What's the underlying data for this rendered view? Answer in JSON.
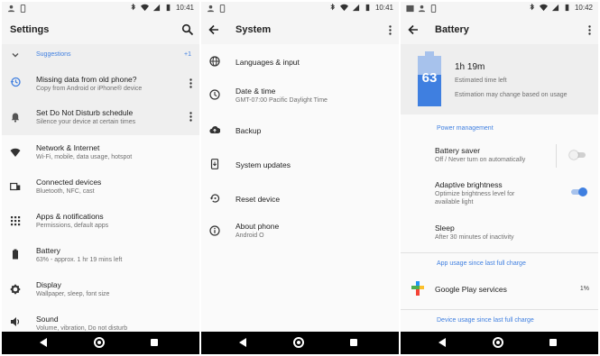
{
  "status": {
    "time_1": "10:41",
    "time_2": "10:41",
    "time_3": "10:42"
  },
  "settings": {
    "title": "Settings",
    "suggestions_label": "Suggestions",
    "suggestions_count": "+1",
    "items": [
      {
        "title": "Missing data from old phone?",
        "subtitle": "Copy from Android or iPhone® device",
        "icon": "history-icon"
      },
      {
        "title": "Set Do Not Disturb schedule",
        "subtitle": "Silence your device at certain times",
        "icon": "bell-icon"
      },
      {
        "title": "Network & Internet",
        "subtitle": "Wi-Fi, mobile, data usage, hotspot",
        "icon": "wifi-icon"
      },
      {
        "title": "Connected devices",
        "subtitle": "Bluetooth, NFC, cast",
        "icon": "devices-icon"
      },
      {
        "title": "Apps & notifications",
        "subtitle": "Permissions, default apps",
        "icon": "apps-icon"
      },
      {
        "title": "Battery",
        "subtitle": "63% - approx. 1 hr 19 mins left",
        "icon": "battery-icon"
      },
      {
        "title": "Display",
        "subtitle": "Wallpaper, sleep, font size",
        "icon": "brightness-icon"
      },
      {
        "title": "Sound",
        "subtitle": "Volume, vibration, Do not disturb",
        "icon": "volume-icon"
      }
    ]
  },
  "system": {
    "title": "System",
    "items": [
      {
        "title": "Languages & input",
        "subtitle": "",
        "icon": "globe-icon"
      },
      {
        "title": "Date & time",
        "subtitle": "GMT-07:00 Pacific Daylight Time",
        "icon": "clock-icon"
      },
      {
        "title": "Backup",
        "subtitle": "",
        "icon": "cloud-upload-icon"
      },
      {
        "title": "System updates",
        "subtitle": "",
        "icon": "system-update-icon"
      },
      {
        "title": "Reset device",
        "subtitle": "",
        "icon": "restore-icon"
      },
      {
        "title": "About phone",
        "subtitle": "Android O",
        "icon": "info-icon"
      }
    ]
  },
  "battery": {
    "title": "Battery",
    "level": "63",
    "level_fraction": 0.63,
    "time_left": "1h 19m",
    "estimated_label": "Estimated time left",
    "estimate_note": "Estimation may change based on usage",
    "power_management_label": "Power management",
    "saver_title": "Battery saver",
    "saver_subtitle": "Off / Never turn on automatically",
    "saver_on": false,
    "adaptive_title": "Adaptive brightness",
    "adaptive_subtitle_1": "Optimize brightness level for",
    "adaptive_subtitle_2": "available light",
    "adaptive_on": true,
    "sleep_title": "Sleep",
    "sleep_subtitle": "After 30 minutes of inactivity",
    "app_usage_label": "App usage since last full charge",
    "app_name": "Google Play services",
    "app_percent": "1%",
    "device_usage_label": "Device usage since last full charge"
  },
  "colors": {
    "accent": "#3f7fe0",
    "battery_fill": "#3f7fe0",
    "battery_empty": "#a7c2ec"
  }
}
